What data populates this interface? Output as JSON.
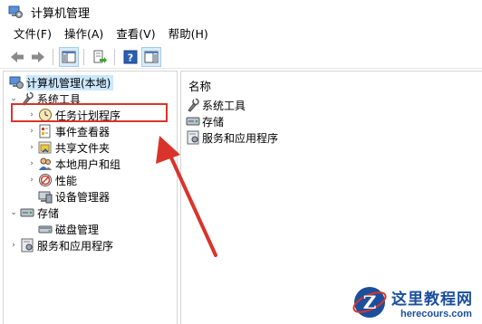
{
  "window": {
    "title": "计算机管理"
  },
  "menu": [
    "文件(F)",
    "操作(A)",
    "查看(V)",
    "帮助(H)"
  ],
  "toolbar": {
    "buttons": [
      "back-icon",
      "forward-icon",
      "show-hide-tree-icon",
      "export-list-icon",
      "help-icon",
      "action-pane-icon"
    ]
  },
  "tree": {
    "root": "计算机管理(本地)",
    "system_tools": "系统工具",
    "task_scheduler": "任务计划程序",
    "event_viewer": "事件查看器",
    "shared_folders": "共享文件夹",
    "local_users": "本地用户和组",
    "performance": "性能",
    "device_manager": "设备管理器",
    "storage": "存储",
    "disk_management": "磁盘管理",
    "services_apps": "服务和应用程序"
  },
  "list": {
    "header": "名称",
    "items": [
      "系统工具",
      "存储",
      "服务和应用程序"
    ]
  },
  "watermark": {
    "cn": "这里教程网",
    "en": "herecours.com"
  },
  "colors": {
    "selection": "#cce8ff",
    "annotation": "#d9342b",
    "watermark": "#1b4f9c"
  }
}
